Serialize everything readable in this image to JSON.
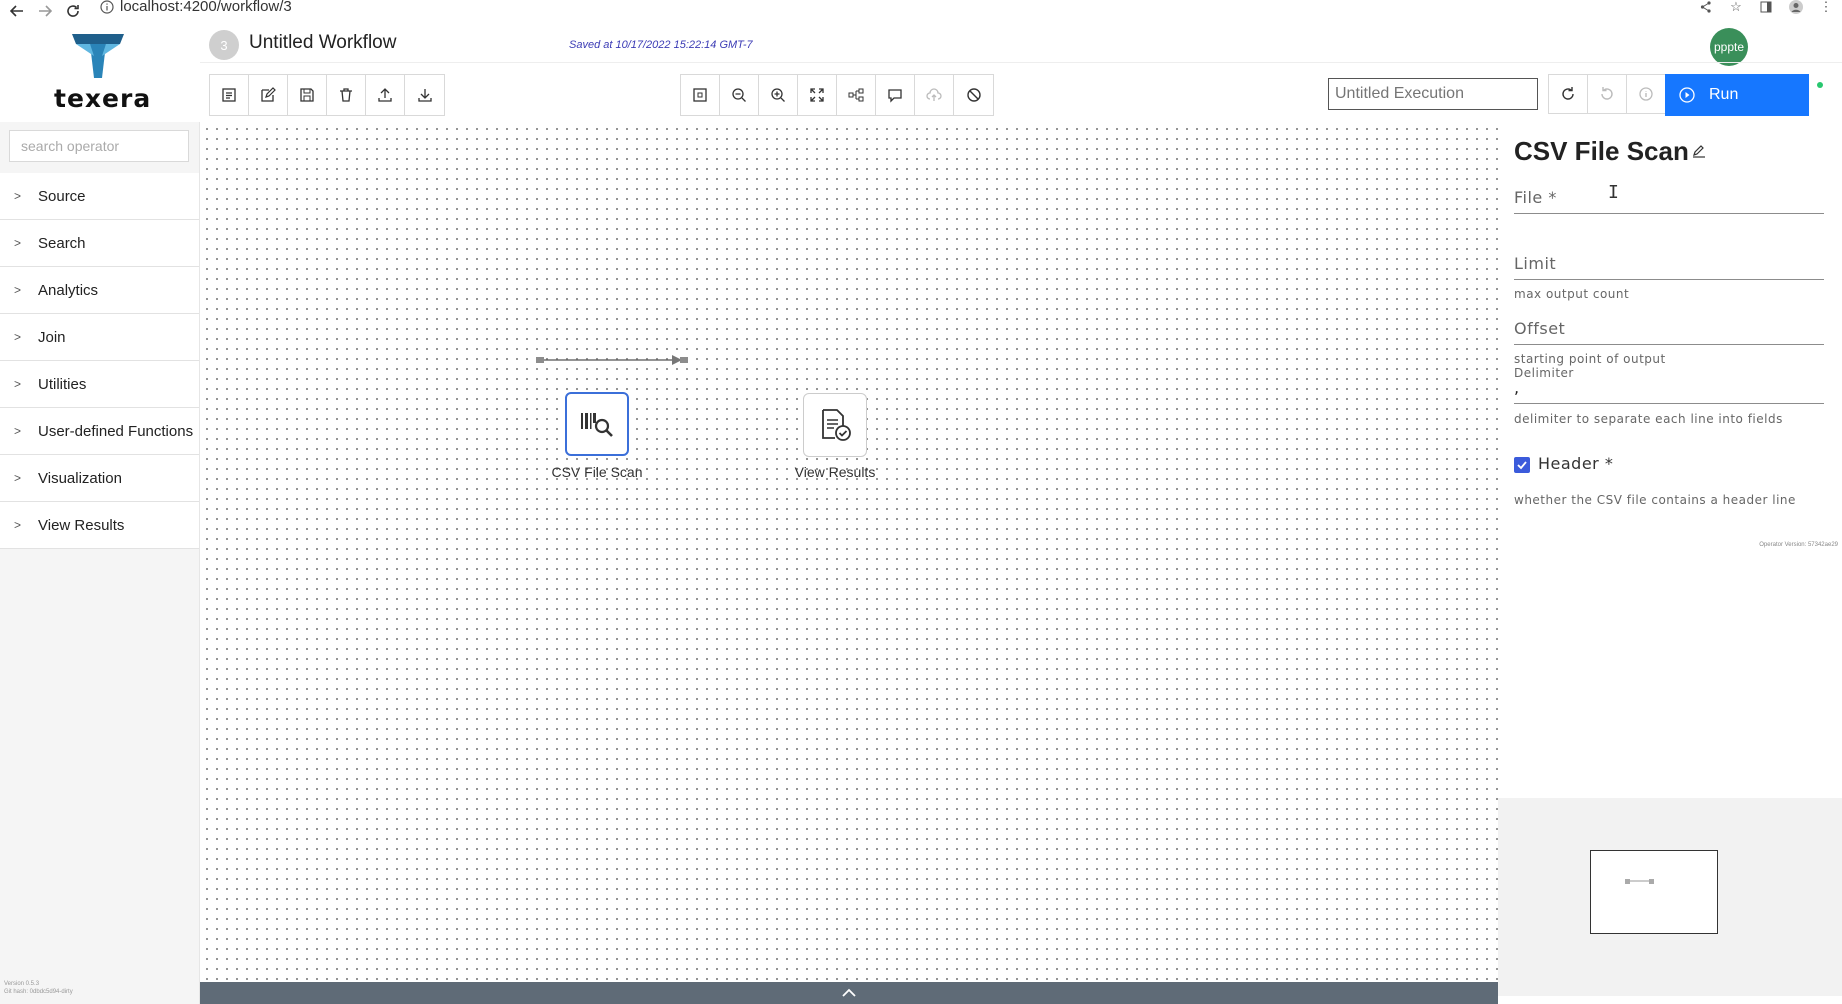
{
  "browser": {
    "url": "localhost:4200/workflow/3"
  },
  "logo": {
    "text": "texera"
  },
  "sidebar": {
    "search_placeholder": "search operator",
    "items": [
      {
        "label": "Source"
      },
      {
        "label": "Search"
      },
      {
        "label": "Analytics"
      },
      {
        "label": "Join"
      },
      {
        "label": "Utilities"
      },
      {
        "label": "User-defined Functions"
      },
      {
        "label": "Visualization"
      },
      {
        "label": "View Results"
      }
    ],
    "version": "Version 0.5.3",
    "git_hash": "Git hash: 0dbdc5d94-dirty"
  },
  "header": {
    "workflow_id": "3",
    "workflow_title": "Untitled Workflow",
    "saved_status": "Saved at 10/17/2022 15:22:14 GMT-7",
    "user_avatar": "pppte",
    "execution_name_placeholder": "Untitled Execution",
    "run_label": "Run"
  },
  "toolbar": {
    "left_icons": [
      "document-icon",
      "edit-icon",
      "save-icon",
      "delete-icon",
      "upload-icon",
      "download-icon"
    ],
    "center_icons": [
      "fit-screen-icon",
      "zoom-out-icon",
      "zoom-in-icon",
      "fullscreen-icon",
      "layout-icon",
      "comment-icon",
      "cloud-upload-icon",
      "disable-icon"
    ],
    "right_icons": [
      "refresh-icon",
      "undo-icon",
      "info-icon"
    ]
  },
  "canvas": {
    "operators": [
      {
        "label": "CSV File Scan",
        "icon": "file-scan-icon",
        "selected": true
      },
      {
        "label": "View Results",
        "icon": "view-results-icon",
        "selected": false
      }
    ]
  },
  "properties": {
    "operator_title": "CSV File Scan",
    "fields": {
      "file_label": "File *",
      "limit_label": "Limit",
      "limit_hint": "max output count",
      "offset_label": "Offset",
      "offset_hint": "starting point of output",
      "delimiter_label": "Delimiter",
      "delimiter_value": ",",
      "delimiter_hint": "delimiter to separate each line into fields",
      "header_label": "Header *",
      "header_checked": true,
      "header_hint": "whether the CSV file contains a header line"
    },
    "operator_version": "Operator Version: 57342ae29"
  },
  "colors": {
    "run_button": "#1677ff",
    "status_dot": "#28c76f",
    "avatar": "#3a8f5a",
    "result_bar": "#5f6b77",
    "selected_border": "#3b6fd9"
  }
}
